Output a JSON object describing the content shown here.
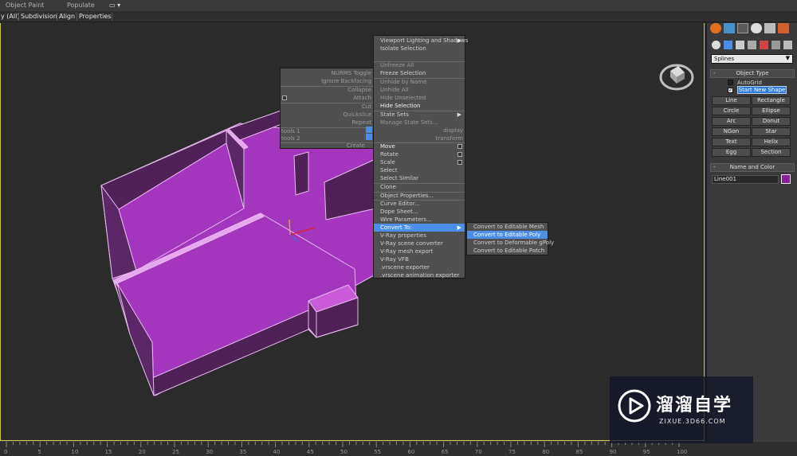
{
  "top_tabs": [
    "Object Paint",
    "Populate"
  ],
  "ribbon": [
    "y (All)",
    "Subdivision",
    "Align",
    "Properties"
  ],
  "command_panel": {
    "dropdown": "Splines",
    "object_type": {
      "title": "Object Type",
      "autogrid": "AutoGrid",
      "start_new_shape": "Start New Shape",
      "buttons": [
        "Line",
        "Rectangle",
        "Circle",
        "Ellipse",
        "Arc",
        "Donut",
        "NGon",
        "Star",
        "Text",
        "Helix",
        "Egg",
        "Section"
      ]
    },
    "name_and_color": {
      "title": "Name and Color",
      "name": "Line001",
      "color": "#8b1e9a"
    }
  },
  "left_quad": {
    "items": [
      "NURMS Toggle",
      "Ignore Backfacing",
      "Collapse",
      "Attach",
      "Cut",
      "Quickslice",
      "Repeat"
    ],
    "tools1_left": "tools 1",
    "tools1_right": "display",
    "tools2_left": "tools 2",
    "tools2_right": "transform",
    "create": "Create"
  },
  "right_quad": {
    "display": [
      "Viewport Lighting and Shadows",
      "Isolate Selection",
      "Unfreeze All",
      "Freeze Selection",
      "Unhide by Name",
      "Unhide All",
      "Hide Unselected",
      "Hide Selection",
      "State Sets",
      "Manage State Sets..."
    ],
    "transform": [
      "Move",
      "Rotate",
      "Scale",
      "Select",
      "Select Similar",
      "Clone",
      "Object Properties...",
      "Curve Editor...",
      "Dope Sheet...",
      "Wire Parameters...",
      "Convert To:",
      "V-Ray properties",
      "V-Ray scene converter",
      "V-Ray mesh export",
      "V-Ray VFB",
      ".vrscene exporter",
      ".vrscene animation exporter"
    ]
  },
  "convert_submenu": [
    "Convert to Editable Mesh",
    "Convert to Editable Poly",
    "Convert to Deformable gPoly",
    "Convert to Editable Patch"
  ],
  "timeline": {
    "labels": [
      "0",
      "5",
      "10",
      "15",
      "20",
      "25",
      "30",
      "35",
      "40",
      "45",
      "50",
      "55",
      "60",
      "65",
      "70",
      "75",
      "80",
      "85",
      "90",
      "95",
      "100"
    ]
  },
  "watermark": {
    "title": "溜溜自学",
    "subtitle": "ZIXUE.3D66.COM"
  },
  "colors": {
    "accent": "#4a8ee8",
    "viewport_border": "#d8c350",
    "model_floor": "#a033b8",
    "model_wall": "#4a1e52"
  }
}
